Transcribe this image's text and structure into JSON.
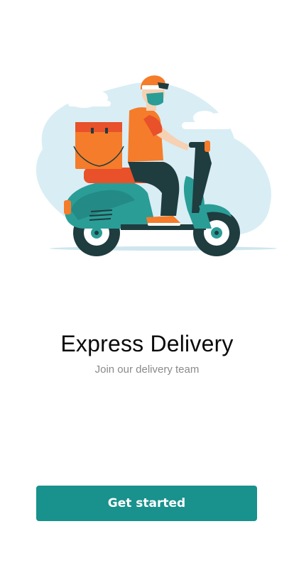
{
  "hero": {
    "illustration": "scooter-delivery-rider"
  },
  "intro": {
    "title": "Express Delivery",
    "subtitle": "Join our delivery team"
  },
  "actions": {
    "get_started_label": "Get started"
  },
  "colors": {
    "accent": "#19918d",
    "illustration_orange": "#f57c2a",
    "illustration_teal": "#2a9d97",
    "illustration_bg": "#d9edf4"
  }
}
